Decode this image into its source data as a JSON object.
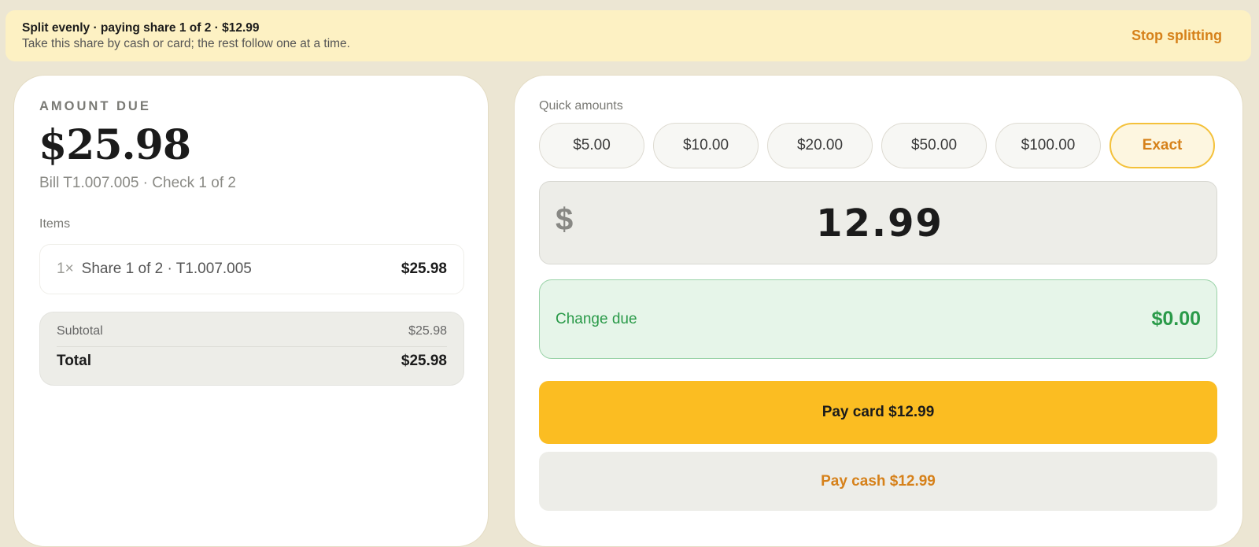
{
  "banner": {
    "title": "Split evenly · paying share 1 of 2 · $12.99",
    "subtitle": "Take this share by cash or card; the rest follow one at a time.",
    "stop_label": "Stop splitting"
  },
  "summary": {
    "amount_due_label": "AMOUNT DUE",
    "amount_due": "$25.98",
    "bill_ref": "Bill T1.007.005 · Check 1 of 2",
    "items_label": "Items",
    "items": [
      {
        "qty": "1×",
        "name": "Share 1 of 2 · T1.007.005",
        "price": "$25.98"
      }
    ],
    "subtotal_label": "Subtotal",
    "subtotal": "$25.98",
    "total_label": "Total",
    "total": "$25.98"
  },
  "payment": {
    "quick_label": "Quick amounts",
    "quick_amounts": [
      "$5.00",
      "$10.00",
      "$20.00",
      "$50.00",
      "$100.00"
    ],
    "exact_label": "Exact",
    "currency_symbol": "$",
    "tendered_value": "12.99",
    "change_label": "Change due",
    "change_value": "$0.00",
    "pay_card_label": "Pay card $12.99",
    "pay_cash_label": "Pay cash $12.99"
  },
  "colors": {
    "accent": "#fbbd22",
    "accent_text": "#d6811a",
    "success": "#2a9a49",
    "banner_bg": "#fdf1c3"
  }
}
